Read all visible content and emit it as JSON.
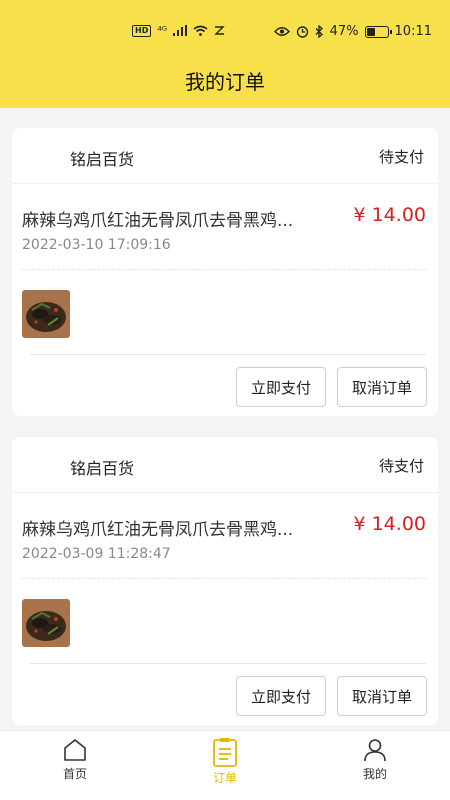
{
  "status_bar": {
    "left_badges": [
      "HD",
      "⁴ᴳ"
    ],
    "battery": "47%",
    "battery_level": 0.47,
    "time": "10:11"
  },
  "header": {
    "title": "我的订单"
  },
  "orders": [
    {
      "shop": "铭启百货",
      "status": "待支付",
      "product": "麻辣乌鸡爪红油无骨凤爪去骨黑鸡...",
      "price": "¥ 14.00",
      "time": "2022-03-10 17:09:16",
      "pay_label": "立即支付",
      "cancel_label": "取消订单"
    },
    {
      "shop": "铭启百货",
      "status": "待支付",
      "product": "麻辣乌鸡爪红油无骨凤爪去骨黑鸡...",
      "price": "¥ 14.00",
      "time": "2022-03-09 11:28:47",
      "pay_label": "立即支付",
      "cancel_label": "取消订单"
    }
  ],
  "tabbar": {
    "items": [
      {
        "label": "首页",
        "icon": "home-icon"
      },
      {
        "label": "订单",
        "icon": "orders-icon",
        "active": true
      },
      {
        "label": "我的",
        "icon": "user-icon"
      }
    ]
  },
  "colors": {
    "accent": "#f7e04a",
    "price": "#d81e1e",
    "active_tab": "#e2b800"
  }
}
